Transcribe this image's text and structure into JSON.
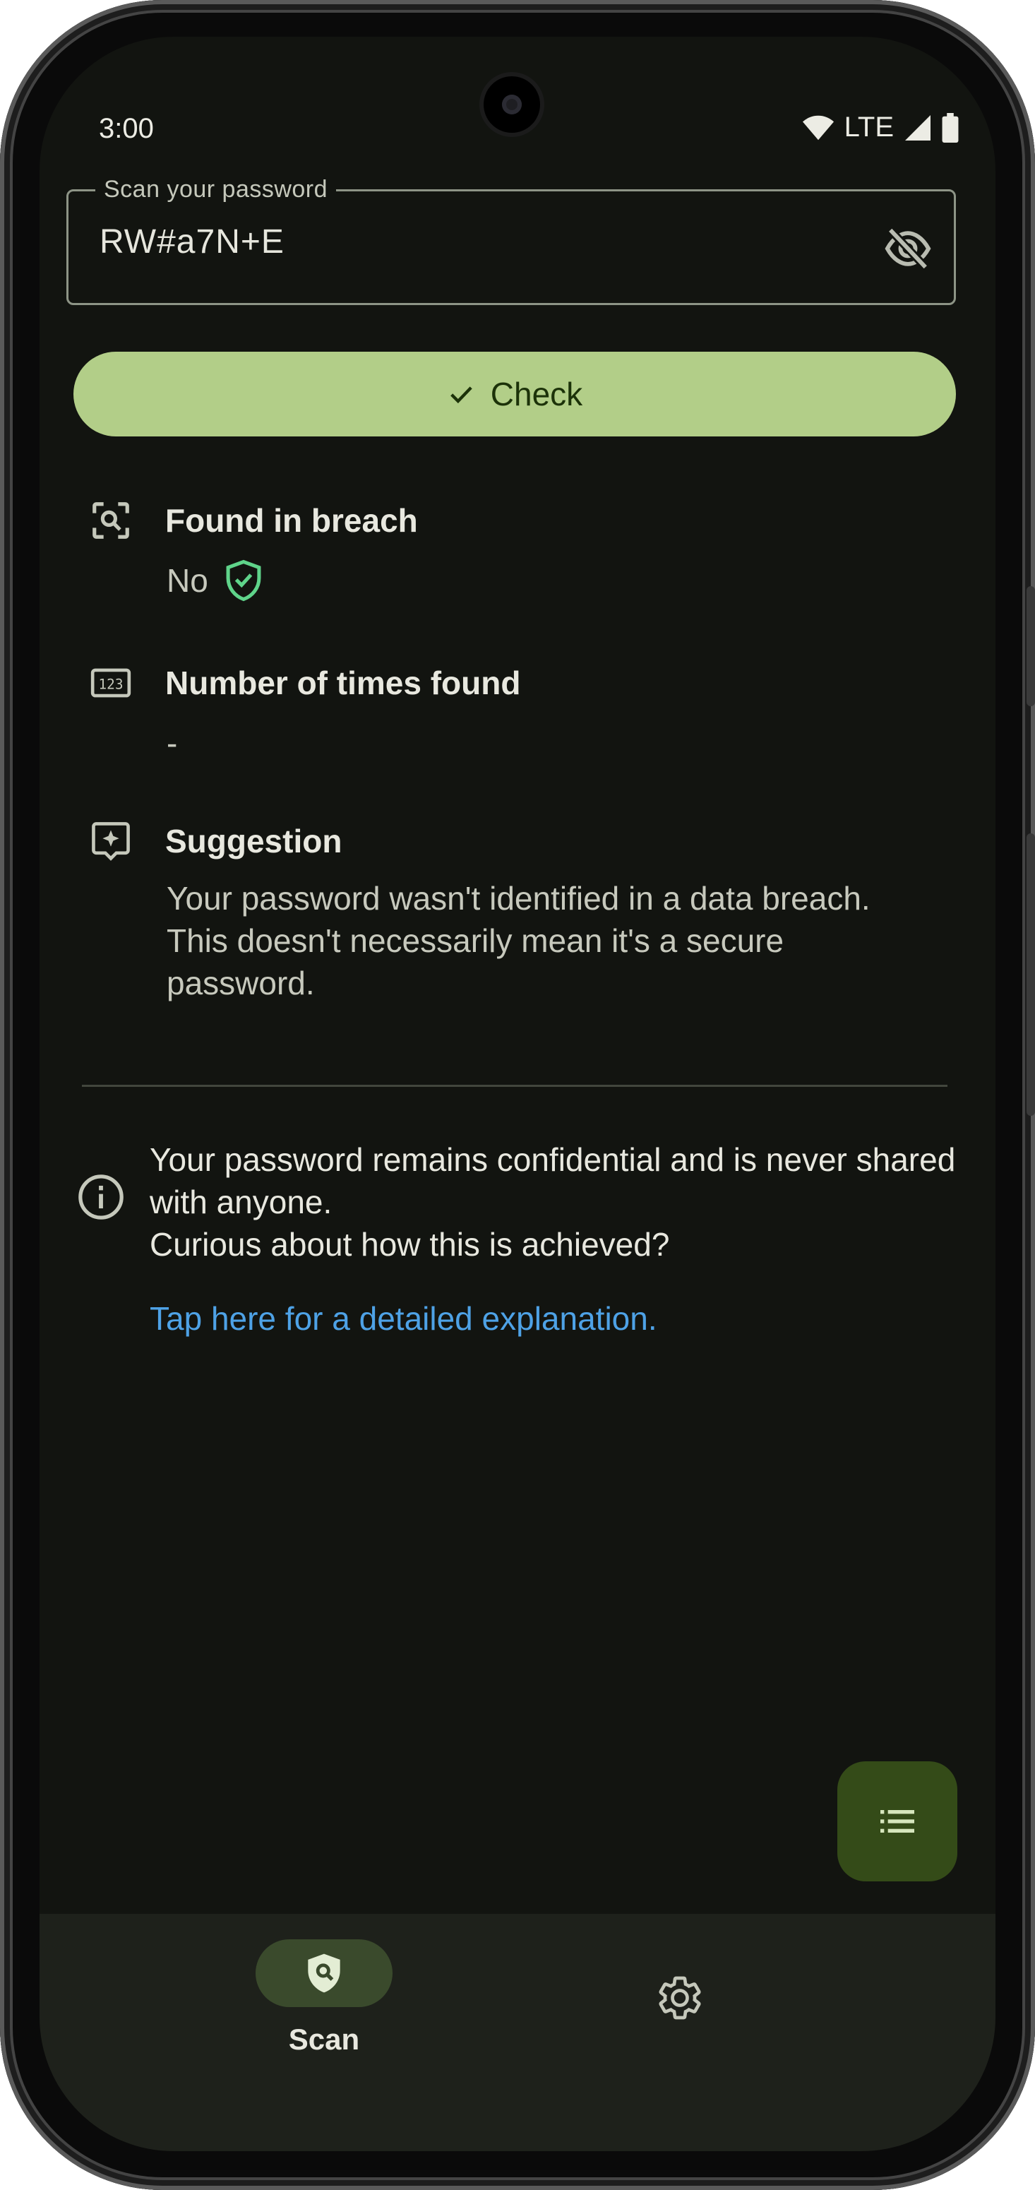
{
  "status_bar": {
    "time": "3:00",
    "network": "LTE"
  },
  "password_field": {
    "label": "Scan your password",
    "value": "RW#a7N+E"
  },
  "check_button": {
    "label": "Check"
  },
  "results": {
    "breach": {
      "title": "Found in breach",
      "value": "No"
    },
    "count": {
      "title": "Number of times found",
      "value": "-"
    },
    "suggestion": {
      "title": "Suggestion",
      "line1": "Your password wasn't identified in a data breach.",
      "line2": "This doesn't necessarily mean it's a secure password."
    }
  },
  "info": {
    "line1": "Your password remains confidential and is never shared with anyone.",
    "line2": "Curious about how this is achieved?",
    "link": "Tap here for a detailed explanation."
  },
  "bottom_nav": {
    "scan_label": "Scan"
  },
  "colors": {
    "background": "#121410",
    "accent": "#b2ce88",
    "fab": "#344b18",
    "link": "#4ea2e6",
    "safe_green": "#5fd48a"
  }
}
